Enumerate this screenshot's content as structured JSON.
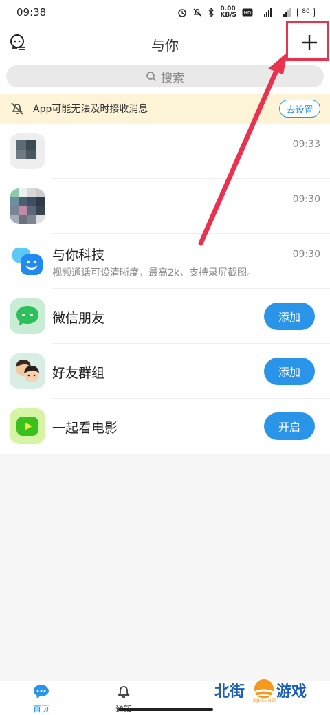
{
  "status_bar": {
    "time": "09:38",
    "network_speed": "0.00\nKB/S",
    "battery": "80"
  },
  "header": {
    "title": "与你"
  },
  "search": {
    "placeholder": "搜索"
  },
  "notice": {
    "text": "App可能无法及时接收消息",
    "button_label": "去设置"
  },
  "list": [
    {
      "title": "",
      "subtitle": "",
      "time": "09:33"
    },
    {
      "title": "",
      "subtitle": "",
      "time": "09:30"
    },
    {
      "title": "与你科技",
      "subtitle": "视频通话可设清晰度，最高2k，支持录屏截图。",
      "time": "09:30"
    },
    {
      "title": "微信朋友",
      "button": "添加"
    },
    {
      "title": "好友群组",
      "button": "添加"
    },
    {
      "title": "一起看电影",
      "button": "开启"
    }
  ],
  "bottom_nav": {
    "home_label": "首页",
    "notify_label": "通知"
  },
  "watermark": {
    "text_left": "北街",
    "text_right": "游戏",
    "url": "BJJHXS.NET"
  },
  "colors": {
    "accent": "#2a95e8",
    "annotation": "#e8324e",
    "notice_bg": "#fdf3d6"
  }
}
